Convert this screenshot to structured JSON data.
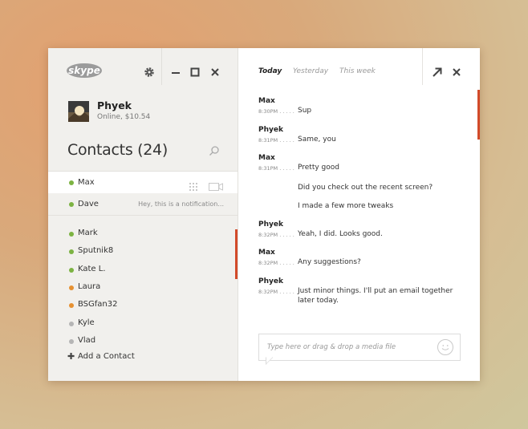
{
  "app": {
    "logo_text": "skype"
  },
  "profile": {
    "name": "Phyek",
    "status": "Online, $10.54"
  },
  "contacts_header": {
    "title": "Contacts (24)"
  },
  "active_contact": {
    "name": "Max",
    "status_color": "#7cb342"
  },
  "dave": {
    "name": "Dave",
    "notification": "Hey, this is a notification...",
    "status_color": "#7cb342"
  },
  "contacts": [
    {
      "name": "Mark",
      "status_color": "#7cb342"
    },
    {
      "name": "Sputnik8",
      "status_color": "#7cb342"
    },
    {
      "name": "Kate L.",
      "status_color": "#7cb342"
    },
    {
      "name": "Laura",
      "status_color": "#e69131"
    },
    {
      "name": "BSGfan32",
      "status_color": "#e69131"
    },
    {
      "name": "Kyle",
      "status_color": "#b5b5b5"
    },
    {
      "name": "Vlad",
      "status_color": "#b5b5b5"
    }
  ],
  "add_contact": {
    "label": "Add a Contact"
  },
  "tabs": [
    {
      "label": "Today",
      "active": true
    },
    {
      "label": "Yesterday",
      "active": false
    },
    {
      "label": "This week",
      "active": false
    }
  ],
  "messages": [
    {
      "sender": "Max",
      "time": "8:30PM . . . . .",
      "lines": [
        "Sup"
      ]
    },
    {
      "sender": "Phyek",
      "time": "8:31PM . . . . .",
      "lines": [
        "Same, you"
      ]
    },
    {
      "sender": "Max",
      "time": "8:31PM . . . . .",
      "lines": [
        "Pretty good"
      ]
    },
    {
      "sender": "",
      "time": "",
      "lines": [
        "Did you check out the recent screen?"
      ]
    },
    {
      "sender": "",
      "time": "",
      "lines": [
        "I made a few more tweaks"
      ]
    },
    {
      "sender": "Phyek",
      "time": "8:32PM . . . . .",
      "lines": [
        "Yeah, I did. Looks good."
      ]
    },
    {
      "sender": "Max",
      "time": "8:32PM . . . . .",
      "lines": [
        "Any suggestions?"
      ]
    },
    {
      "sender": "Phyek",
      "time": "8:32PM . . . . .",
      "lines": [
        "Just minor things. I'll put an email together",
        "later today."
      ]
    }
  ],
  "composer": {
    "placeholder": "Type here or drag & drop a media file"
  },
  "colors": {
    "accent": "#d24a2a",
    "skype_blue": "#8a8a8a"
  }
}
